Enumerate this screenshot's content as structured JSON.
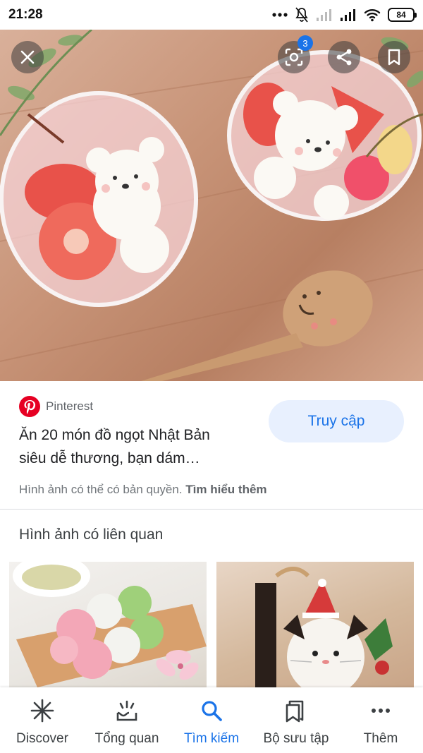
{
  "status_bar": {
    "time": "21:28",
    "battery": "84"
  },
  "hero": {
    "lens_badge_count": "3",
    "icons": [
      "close-icon",
      "lens-icon",
      "share-icon",
      "bookmark-icon"
    ]
  },
  "result": {
    "source": "Pinterest",
    "title_line1": "Ăn 20 món đồ ngọt Nhật Bản",
    "title_line2": "siêu dễ thương, bạn dám…",
    "visit_label": "Truy cập",
    "copyright_text": "Hình ảnh có thể có bản quyền. ",
    "learn_more": "Tìm hiểu thêm"
  },
  "related": {
    "heading": "Hình ảnh có liên quan"
  },
  "bottom_nav": {
    "items": [
      {
        "label": "Discover",
        "icon": "asterisk-icon"
      },
      {
        "label": "Tổng quan",
        "icon": "updates-icon"
      },
      {
        "label": "Tìm kiếm",
        "icon": "search-icon",
        "active": true
      },
      {
        "label": "Bộ sưu tập",
        "icon": "collections-icon"
      },
      {
        "label": "Thêm",
        "icon": "more-icon"
      }
    ]
  },
  "colors": {
    "accent": "#1a73e8",
    "visit_bg": "#e8f0fe",
    "pinterest": "#e60023"
  }
}
